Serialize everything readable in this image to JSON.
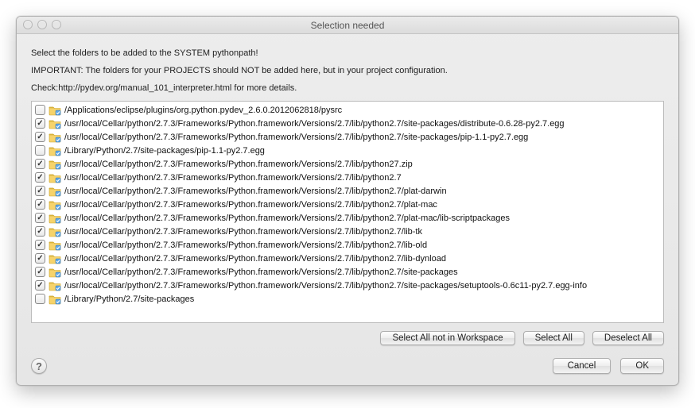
{
  "window": {
    "title": "Selection needed"
  },
  "messages": {
    "line1": "Select the folders to be added to the SYSTEM pythonpath!",
    "line2": "IMPORTANT: The folders for your PROJECTS should NOT be added here, but in your project configuration.",
    "line3": "Check:http://pydev.org/manual_101_interpreter.html for more details."
  },
  "items": [
    {
      "checked": false,
      "path": "/Applications/eclipse/plugins/org.python.pydev_2.6.0.2012062818/pysrc"
    },
    {
      "checked": true,
      "path": "/usr/local/Cellar/python/2.7.3/Frameworks/Python.framework/Versions/2.7/lib/python2.7/site-packages/distribute-0.6.28-py2.7.egg"
    },
    {
      "checked": true,
      "path": "/usr/local/Cellar/python/2.7.3/Frameworks/Python.framework/Versions/2.7/lib/python2.7/site-packages/pip-1.1-py2.7.egg"
    },
    {
      "checked": false,
      "path": "/Library/Python/2.7/site-packages/pip-1.1-py2.7.egg"
    },
    {
      "checked": true,
      "path": "/usr/local/Cellar/python/2.7.3/Frameworks/Python.framework/Versions/2.7/lib/python27.zip"
    },
    {
      "checked": true,
      "path": "/usr/local/Cellar/python/2.7.3/Frameworks/Python.framework/Versions/2.7/lib/python2.7"
    },
    {
      "checked": true,
      "path": "/usr/local/Cellar/python/2.7.3/Frameworks/Python.framework/Versions/2.7/lib/python2.7/plat-darwin"
    },
    {
      "checked": true,
      "path": "/usr/local/Cellar/python/2.7.3/Frameworks/Python.framework/Versions/2.7/lib/python2.7/plat-mac"
    },
    {
      "checked": true,
      "path": "/usr/local/Cellar/python/2.7.3/Frameworks/Python.framework/Versions/2.7/lib/python2.7/plat-mac/lib-scriptpackages"
    },
    {
      "checked": true,
      "path": "/usr/local/Cellar/python/2.7.3/Frameworks/Python.framework/Versions/2.7/lib/python2.7/lib-tk"
    },
    {
      "checked": true,
      "path": "/usr/local/Cellar/python/2.7.3/Frameworks/Python.framework/Versions/2.7/lib/python2.7/lib-old"
    },
    {
      "checked": true,
      "path": "/usr/local/Cellar/python/2.7.3/Frameworks/Python.framework/Versions/2.7/lib/python2.7/lib-dynload"
    },
    {
      "checked": true,
      "path": "/usr/local/Cellar/python/2.7.3/Frameworks/Python.framework/Versions/2.7/lib/python2.7/site-packages"
    },
    {
      "checked": true,
      "path": "/usr/local/Cellar/python/2.7.3/Frameworks/Python.framework/Versions/2.7/lib/python2.7/site-packages/setuptools-0.6c11-py2.7.egg-info"
    },
    {
      "checked": false,
      "path": "/Library/Python/2.7/site-packages"
    }
  ],
  "buttons": {
    "select_not_ws": "Select All not in Workspace",
    "select_all": "Select All",
    "deselect_all": "Deselect All",
    "cancel": "Cancel",
    "ok": "OK"
  }
}
